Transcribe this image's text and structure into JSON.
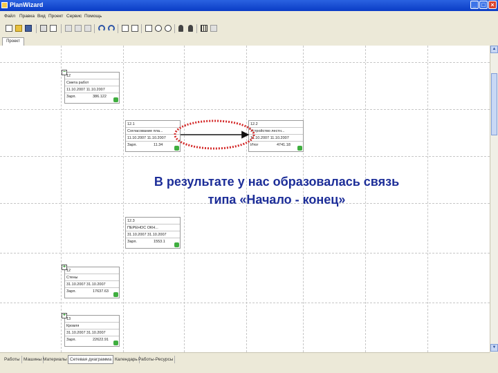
{
  "window": {
    "title": "PlanWizard",
    "icon": "app-icon"
  },
  "menu": {
    "items": [
      "Файл",
      "Правка",
      "Вид",
      "Проект",
      "Сервис",
      "Помощь"
    ]
  },
  "view_tab": {
    "label": "Проект"
  },
  "tasks": [
    {
      "id": "12",
      "name": "Смета работ",
      "dates": "11.10.2007 11.10.2007",
      "cost_label": "Зарп.",
      "cost": "386.122",
      "expanded": true
    },
    {
      "id": "12.1",
      "name": "Согласование пла...",
      "dates": "11.10.2007 11.10.2007",
      "cost_label": "Зарп.",
      "cost": "11.34",
      "expanded": false
    },
    {
      "id": "12.2",
      "name": "Устройство лестн...",
      "dates": "11.10.2007 11.10.2007",
      "cost_label": "Итог",
      "cost": "4741.18",
      "expanded": false
    },
    {
      "id": "12.3",
      "name": "ПЕРЕНОС ОКН...",
      "dates": "31.10.2007 31.10.2007",
      "cost_label": "Зарп.",
      "cost": "1553.1",
      "expanded": false
    },
    {
      "id": "12",
      "name": "Стены",
      "dates": "31.10.2007 31.10.2007",
      "cost_label": "Зарп.",
      "cost": "17637.63",
      "expanded": false
    },
    {
      "id": "13",
      "name": "Кровля",
      "dates": "31.10.2007 31.10.2007",
      "cost_label": "Зарп.",
      "cost": "22622.91",
      "expanded": false
    }
  ],
  "caption": {
    "line1": "В результате у нас образовалась связь",
    "line2": "типа «Начало - конец»",
    "color": "#1c2d98"
  },
  "bottom_tabs": {
    "items": [
      "Работы",
      "Машины",
      "Материалы",
      "Сетевая диаграмма",
      "Календарь",
      "Работы-Ресурсы"
    ],
    "active_index": 3
  },
  "colors": {
    "title_bar": "#0a3cc6",
    "highlight_ellipse": "#d42a2a",
    "status_ok": "#3fae3f"
  }
}
